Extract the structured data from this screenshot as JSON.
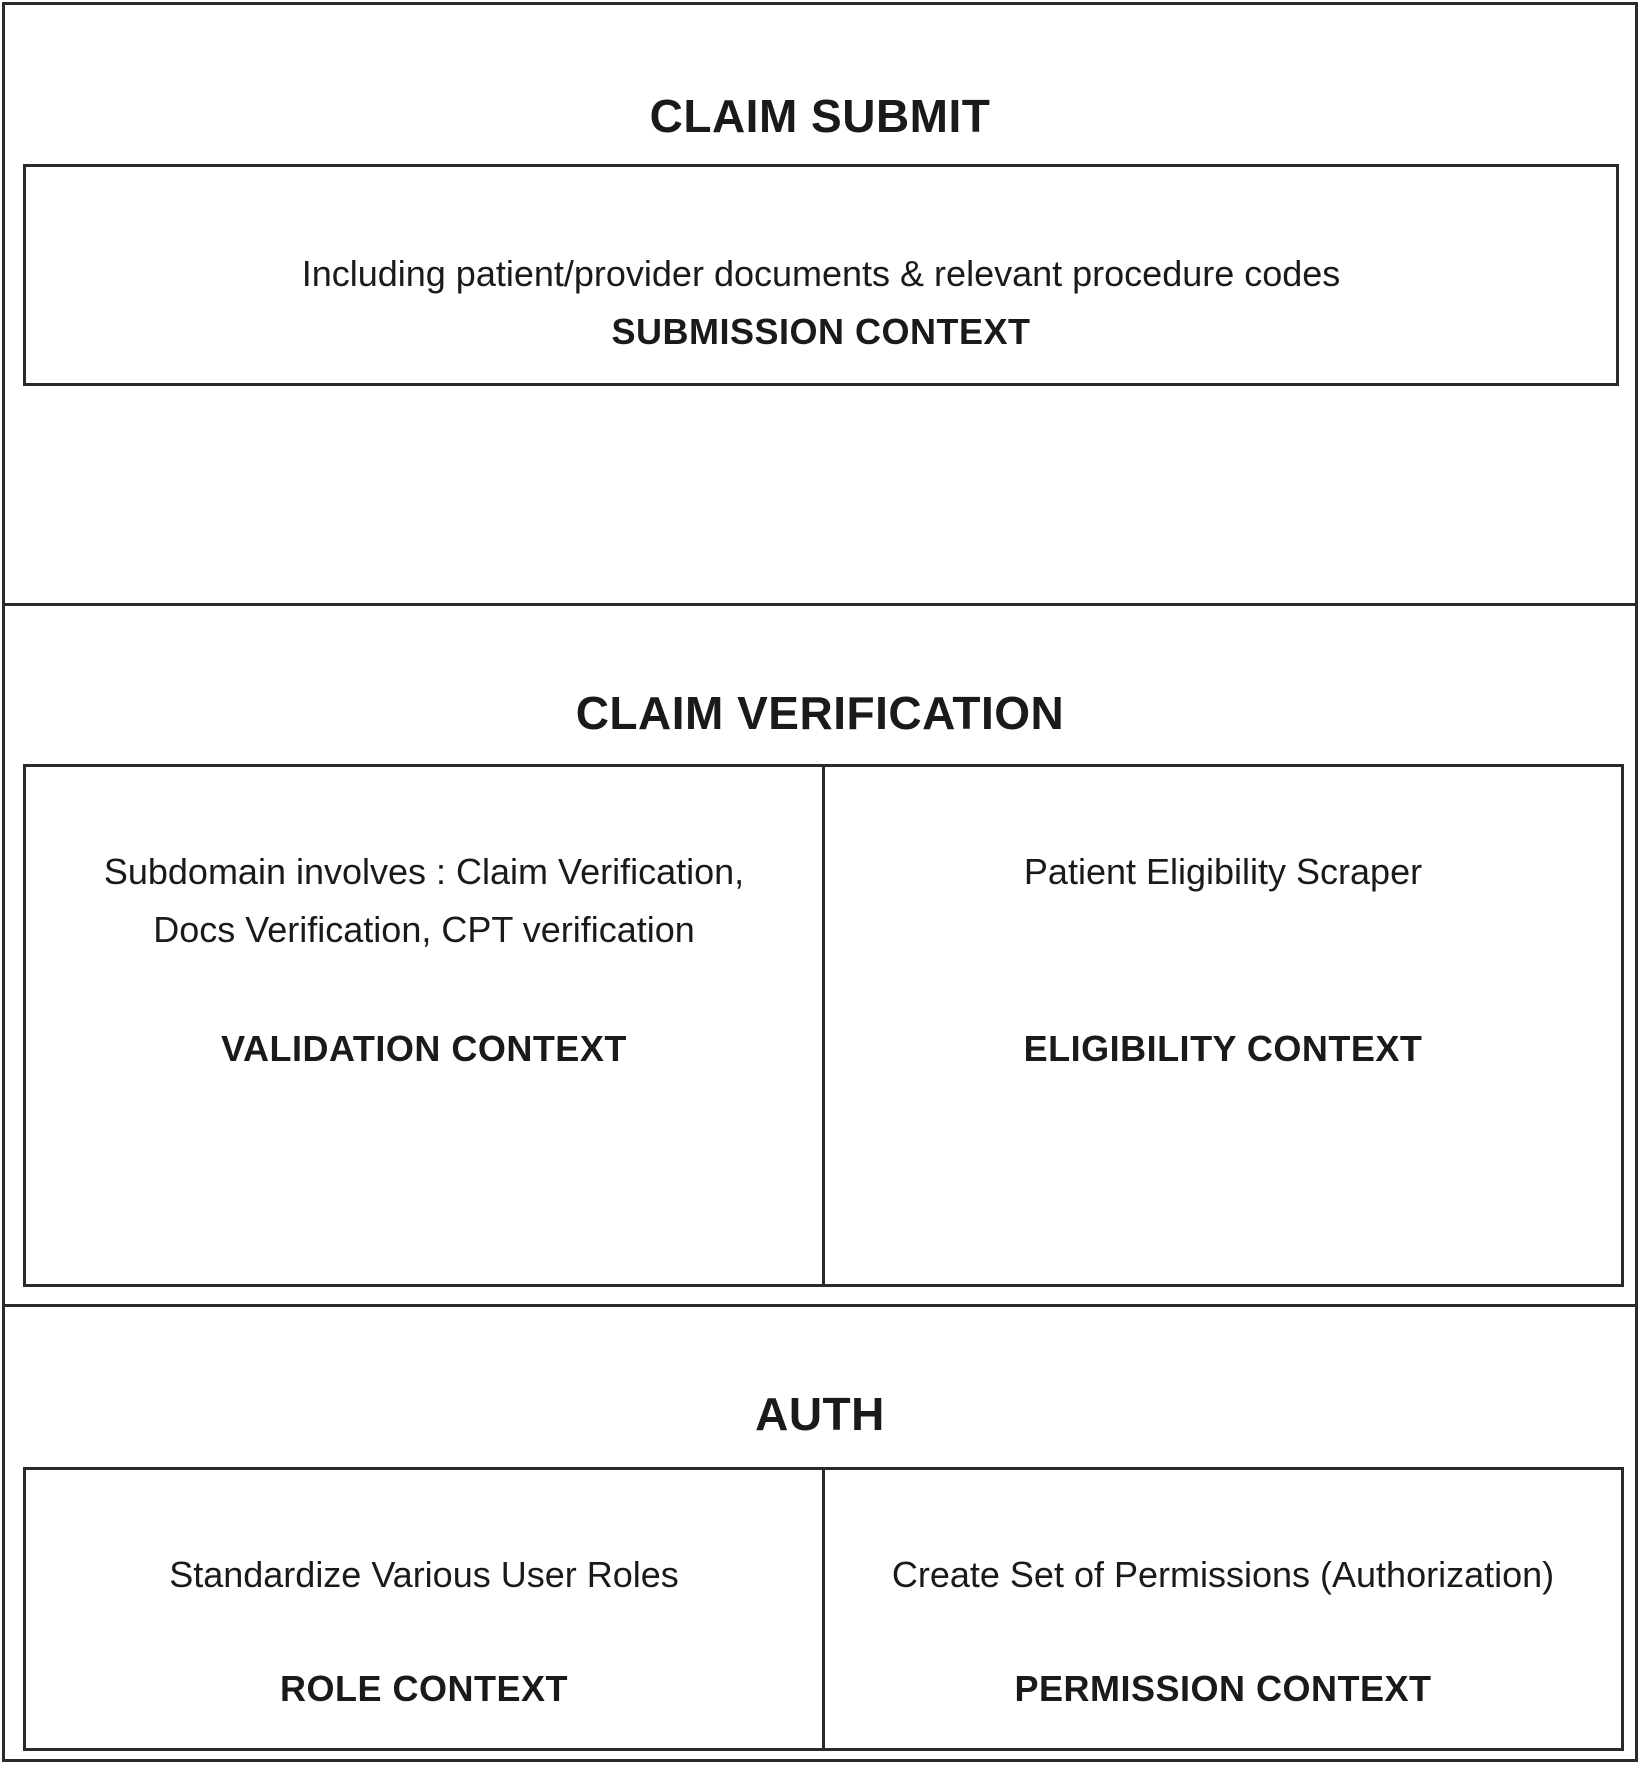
{
  "sections": [
    {
      "title": "CLAIM SUBMIT",
      "contexts": [
        {
          "description": [
            "Including patient/provider documents & relevant procedure codes"
          ],
          "name": "SUBMISSION CONTEXT"
        }
      ]
    },
    {
      "title": "CLAIM VERIFICATION",
      "contexts": [
        {
          "description": [
            "Subdomain involves : Claim Verification,",
            "Docs Verification, CPT verification"
          ],
          "name": "VALIDATION CONTEXT"
        },
        {
          "description": [
            "Patient Eligibility Scraper"
          ],
          "name": "ELIGIBILITY CONTEXT"
        }
      ]
    },
    {
      "title": "AUTH",
      "contexts": [
        {
          "description": [
            "Standardize Various User Roles"
          ],
          "name": "ROLE CONTEXT"
        },
        {
          "description": [
            "Create Set of Permissions (Authorization)"
          ],
          "name": "PERMISSION CONTEXT"
        }
      ]
    }
  ]
}
